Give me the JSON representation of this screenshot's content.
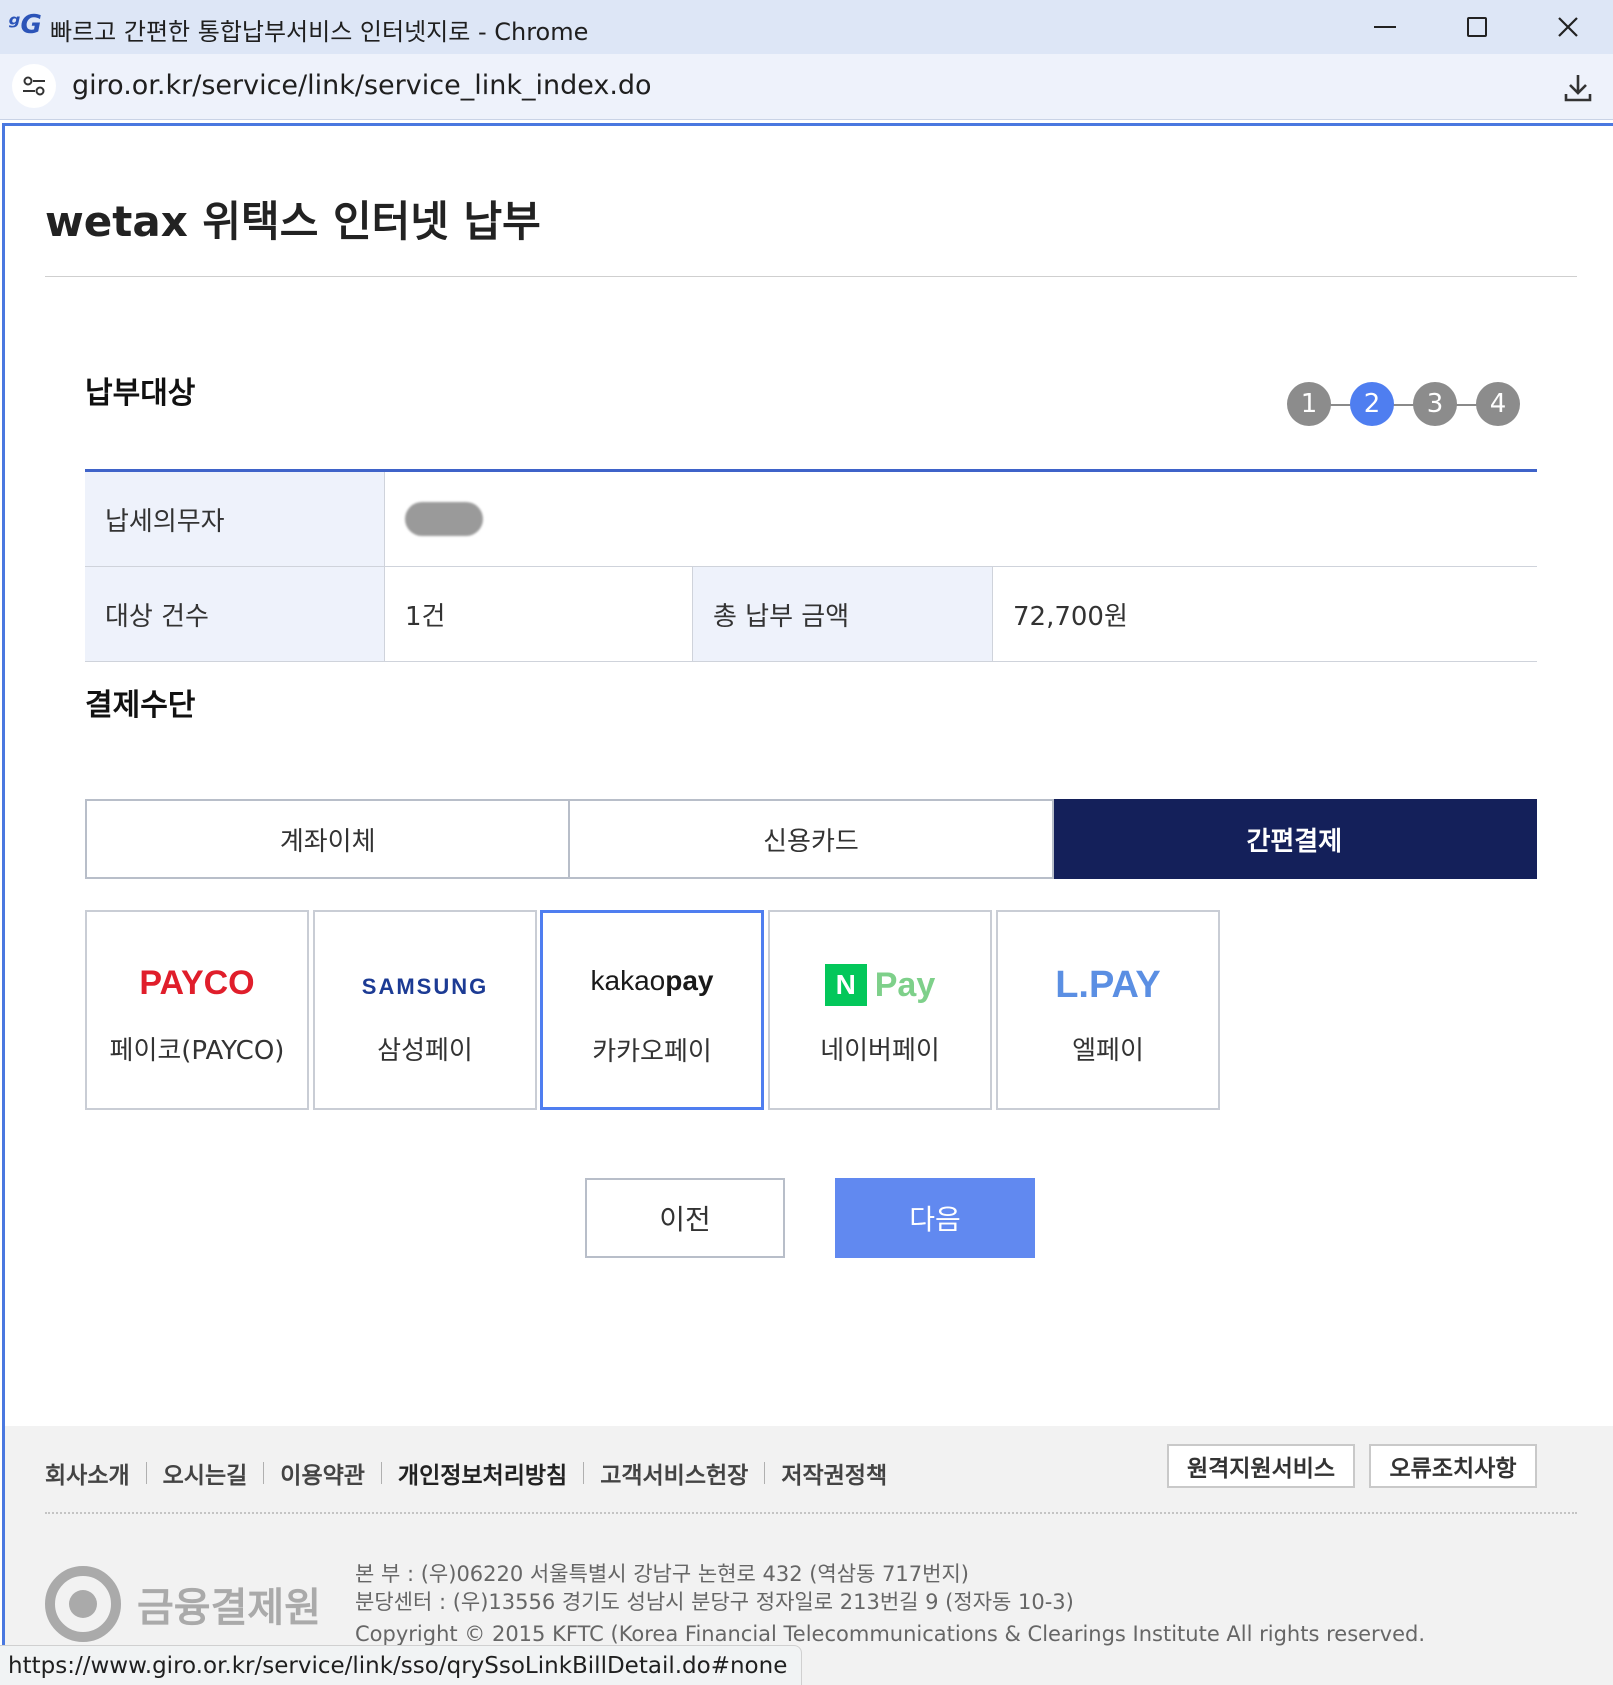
{
  "window": {
    "title": "빠르고 간편한 통합납부서비스 인터넷지로 - Chrome",
    "url": "giro.or.kr/service/link/service_link_index.do"
  },
  "page": {
    "title": "wetax 위택스 인터넷 납부"
  },
  "target_section": {
    "title": "납부대상",
    "steps": [
      "1",
      "2",
      "3",
      "4"
    ],
    "active_step": 2,
    "rows": {
      "taxpayer_label": "납세의무자",
      "count_label": "대상 건수",
      "count_value": "1건",
      "total_label": "총 납부 금액",
      "total_value": "72,700원"
    }
  },
  "payment_section": {
    "title": "결제수단",
    "tabs": [
      "계좌이체",
      "신용카드",
      "간편결제"
    ],
    "active_tab": "간편결제",
    "methods": [
      {
        "logo": "PAYCO",
        "label": "페이코(PAYCO)"
      },
      {
        "logo": "SAMSUNG",
        "label": "삼성페이"
      },
      {
        "logo_a": "kakao",
        "logo_b": "pay",
        "label": "카카오페이",
        "selected": true
      },
      {
        "logo_box": "N",
        "logo": "Pay",
        "label": "네이버페이"
      },
      {
        "logo": "L.PAY",
        "label": "엘페이"
      }
    ]
  },
  "buttons": {
    "prev": "이전",
    "next": "다음"
  },
  "footer": {
    "links": [
      "회사소개",
      "오시는길",
      "이용약관",
      "개인정보처리방침",
      "고객서비스헌장",
      "저작권정책"
    ],
    "remote_button": "원격지원서비스",
    "error_button": "오류조치사항",
    "org_name": "금융결제원",
    "address1": "본 부 : (우)06220 서울특별시 강남구 논현로 432 (역삼동 717번지)",
    "address2": "분당센터 : (우)13556 경기도 성남시 분당구 정자일로 213번길 9 (정자동 10-3)",
    "copyright": "Copyright © 2015 KFTC (Korea Financial Telecommunications & Clearings Institute All rights reserved."
  },
  "status_bar": {
    "link": "https://www.giro.or.kr/service/link/sso/qrySsoLinkBillDetail.do#none"
  },
  "colors": {
    "accent_blue": "#4f7ef0",
    "tab_active": "#14205a",
    "next_button": "#6189f0",
    "payco_red": "#e01e2b",
    "naver_green": "#03c75a"
  }
}
